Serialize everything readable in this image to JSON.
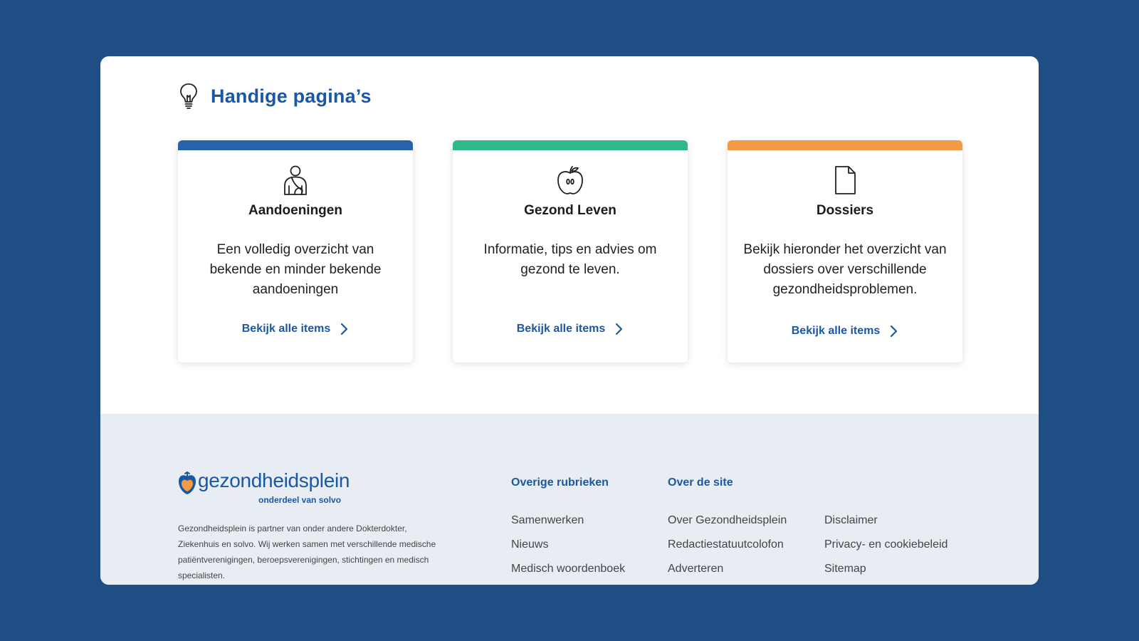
{
  "section": {
    "title": "Handige pagina’s",
    "icon": "lightbulb-icon"
  },
  "cards": [
    {
      "color": "#2862ad",
      "icon": "person-icon",
      "title": "Aandoeningen",
      "description": "Een volledig overzicht van bekende en minder bekende aandoeningen",
      "link": "Bekijk alle items"
    },
    {
      "color": "#2fb88a",
      "icon": "apple-icon",
      "title": "Gezond Leven",
      "description": "Informatie, tips en advies om gezond te leven.",
      "link": "Bekijk alle items"
    },
    {
      "color": "#f39a45",
      "icon": "document-icon",
      "title": "Dossiers",
      "description": "Bekijk hieronder het overzicht van dossiers over verschillende gezondheidsproblemen.",
      "link": "Bekijk alle items"
    }
  ],
  "footer": {
    "logo_text": "gezondheidsplein",
    "logo_sub": "onderdeel van solvo",
    "about": "Gezondheidsplein is partner van onder andere Dokterdokter, Ziekenhuis en solvo. Wij werken samen met verschillende medische patiëntverenigingen, beroepsverenigingen, stichtingen en medisch specialisten.",
    "columns": [
      {
        "heading": "Overige rubrieken",
        "links": [
          "Samenwerken",
          "Nieuws",
          "Medisch woordenboek"
        ]
      },
      {
        "heading": "Over de site",
        "links": [
          "Over Gezondheidsplein",
          "Redactiestatuutcolofon",
          "Adverteren"
        ]
      },
      {
        "heading": "",
        "links": [
          "Disclaimer",
          "Privacy- en cookiebeleid",
          "Sitemap"
        ]
      }
    ]
  }
}
